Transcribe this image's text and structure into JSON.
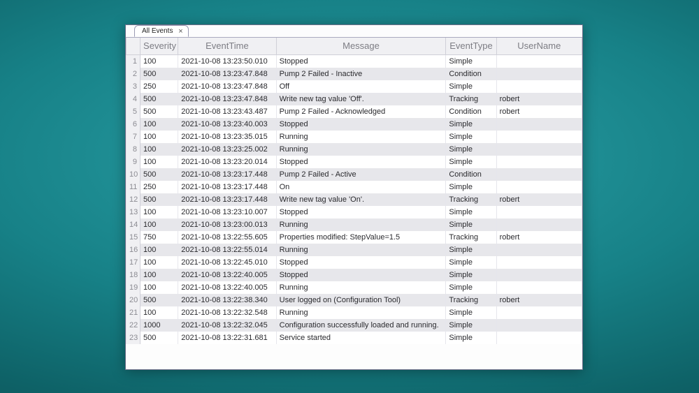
{
  "tab": {
    "label": "All Events"
  },
  "columns": {
    "severity": "Severity",
    "time": "EventTime",
    "message": "Message",
    "type": "EventType",
    "user": "UserName"
  },
  "rows": [
    {
      "n": "1",
      "sev": "100",
      "time": "2021-10-08 13:23:50.010",
      "msg": "Stopped",
      "type": "Simple",
      "user": ""
    },
    {
      "n": "2",
      "sev": "500",
      "time": "2021-10-08 13:23:47.848",
      "msg": "Pump 2 Failed - Inactive",
      "type": "Condition",
      "user": ""
    },
    {
      "n": "3",
      "sev": "250",
      "time": "2021-10-08 13:23:47.848",
      "msg": "Off",
      "type": "Simple",
      "user": ""
    },
    {
      "n": "4",
      "sev": "500",
      "time": "2021-10-08 13:23:47.848",
      "msg": "Write new tag value 'Off'.",
      "type": "Tracking",
      "user": "robert"
    },
    {
      "n": "5",
      "sev": "500",
      "time": "2021-10-08 13:23:43.487",
      "msg": "Pump 2 Failed - Acknowledged",
      "type": "Condition",
      "user": "robert"
    },
    {
      "n": "6",
      "sev": "100",
      "time": "2021-10-08 13:23:40.003",
      "msg": "Stopped",
      "type": "Simple",
      "user": ""
    },
    {
      "n": "7",
      "sev": "100",
      "time": "2021-10-08 13:23:35.015",
      "msg": "Running",
      "type": "Simple",
      "user": ""
    },
    {
      "n": "8",
      "sev": "100",
      "time": "2021-10-08 13:23:25.002",
      "msg": "Running",
      "type": "Simple",
      "user": ""
    },
    {
      "n": "9",
      "sev": "100",
      "time": "2021-10-08 13:23:20.014",
      "msg": "Stopped",
      "type": "Simple",
      "user": ""
    },
    {
      "n": "10",
      "sev": "500",
      "time": "2021-10-08 13:23:17.448",
      "msg": "Pump 2 Failed - Active",
      "type": "Condition",
      "user": ""
    },
    {
      "n": "11",
      "sev": "250",
      "time": "2021-10-08 13:23:17.448",
      "msg": "On",
      "type": "Simple",
      "user": ""
    },
    {
      "n": "12",
      "sev": "500",
      "time": "2021-10-08 13:23:17.448",
      "msg": "Write new tag value 'On'.",
      "type": "Tracking",
      "user": "robert"
    },
    {
      "n": "13",
      "sev": "100",
      "time": "2021-10-08 13:23:10.007",
      "msg": "Stopped",
      "type": "Simple",
      "user": ""
    },
    {
      "n": "14",
      "sev": "100",
      "time": "2021-10-08 13:23:00.013",
      "msg": "Running",
      "type": "Simple",
      "user": ""
    },
    {
      "n": "15",
      "sev": "750",
      "time": "2021-10-08 13:22:55.605",
      "msg": "Properties modified: StepValue=1.5",
      "type": "Tracking",
      "user": "robert"
    },
    {
      "n": "16",
      "sev": "100",
      "time": "2021-10-08 13:22:55.014",
      "msg": "Running",
      "type": "Simple",
      "user": ""
    },
    {
      "n": "17",
      "sev": "100",
      "time": "2021-10-08 13:22:45.010",
      "msg": "Stopped",
      "type": "Simple",
      "user": ""
    },
    {
      "n": "18",
      "sev": "100",
      "time": "2021-10-08 13:22:40.005",
      "msg": "Stopped",
      "type": "Simple",
      "user": ""
    },
    {
      "n": "19",
      "sev": "100",
      "time": "2021-10-08 13:22:40.005",
      "msg": "Running",
      "type": "Simple",
      "user": ""
    },
    {
      "n": "20",
      "sev": "500",
      "time": "2021-10-08 13:22:38.340",
      "msg": "User logged on (Configuration Tool)",
      "type": "Tracking",
      "user": "robert"
    },
    {
      "n": "21",
      "sev": "100",
      "time": "2021-10-08 13:22:32.548",
      "msg": "Running",
      "type": "Simple",
      "user": ""
    },
    {
      "n": "22",
      "sev": "1000",
      "time": "2021-10-08 13:22:32.045",
      "msg": "Configuration successfully loaded and running.",
      "type": "Simple",
      "user": ""
    },
    {
      "n": "23",
      "sev": "500",
      "time": "2021-10-08 13:22:31.681",
      "msg": "Service started",
      "type": "Simple",
      "user": ""
    }
  ]
}
